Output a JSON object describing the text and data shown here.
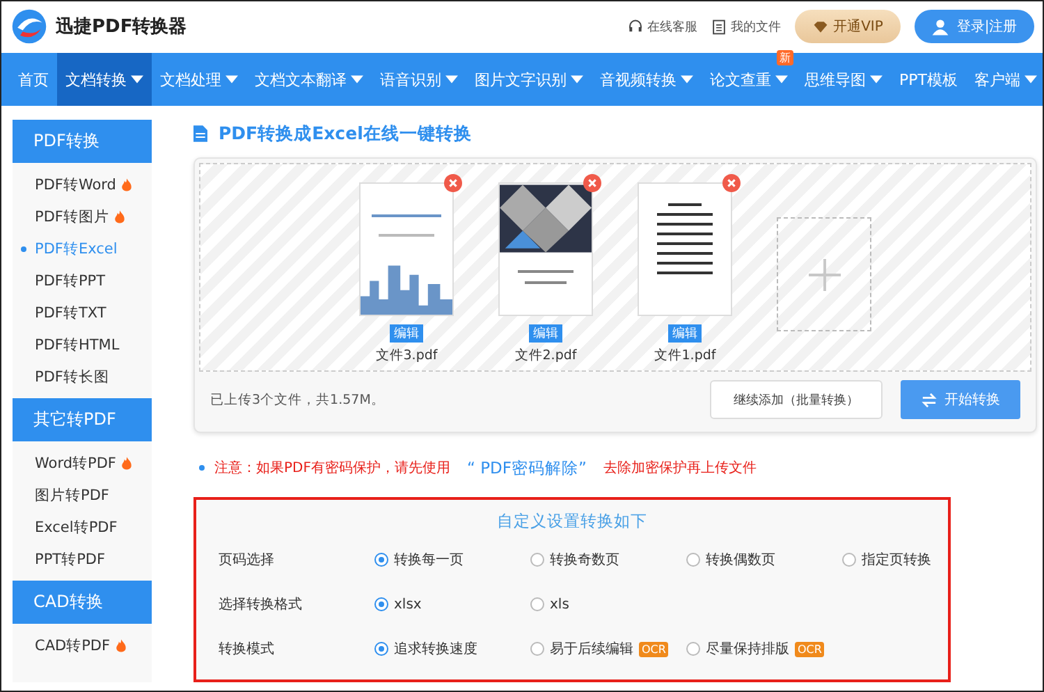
{
  "header": {
    "brand": "迅捷PDF转换器",
    "links": [
      {
        "kind": "headset",
        "label": "在线客服"
      },
      {
        "kind": "file",
        "label": "我的文件"
      }
    ],
    "vip_button": "开通VIP",
    "login_button": "登录|注册"
  },
  "nav": [
    {
      "label": "首页",
      "selected": false,
      "dropdown": false
    },
    {
      "label": "文档转换",
      "selected": true,
      "dropdown": true
    },
    {
      "label": "文档处理",
      "selected": false,
      "dropdown": true
    },
    {
      "label": "文档文本翻译",
      "selected": false,
      "dropdown": true
    },
    {
      "label": "语音识别",
      "selected": false,
      "dropdown": true
    },
    {
      "label": "图片文字识别",
      "selected": false,
      "dropdown": true
    },
    {
      "label": "音视频转换",
      "selected": false,
      "dropdown": true
    },
    {
      "label": "论文查重",
      "selected": false,
      "dropdown": true,
      "badge": "新"
    },
    {
      "label": "思维导图",
      "selected": false,
      "dropdown": true
    },
    {
      "label": "PPT模板",
      "selected": false,
      "dropdown": false
    },
    {
      "label": "客户端",
      "selected": false,
      "dropdown": true
    }
  ],
  "sidebar": [
    {
      "title": "PDF转换",
      "items": [
        {
          "label": "PDF转Word",
          "hot": true,
          "selected": false
        },
        {
          "label": "PDF转图片",
          "hot": true,
          "selected": false
        },
        {
          "label": "PDF转Excel",
          "hot": false,
          "selected": true
        },
        {
          "label": "PDF转PPT",
          "hot": false,
          "selected": false
        },
        {
          "label": "PDF转TXT",
          "hot": false,
          "selected": false
        },
        {
          "label": "PDF转HTML",
          "hot": false,
          "selected": false
        },
        {
          "label": "PDF转长图",
          "hot": false,
          "selected": false
        }
      ]
    },
    {
      "title": "其它转PDF",
      "items": [
        {
          "label": "Word转PDF",
          "hot": true,
          "selected": false
        },
        {
          "label": "图片转PDF",
          "hot": false,
          "selected": false
        },
        {
          "label": "Excel转PDF",
          "hot": false,
          "selected": false
        },
        {
          "label": "PPT转PDF",
          "hot": false,
          "selected": false
        }
      ]
    },
    {
      "title": "CAD转换",
      "items": [
        {
          "label": "CAD转PDF",
          "hot": true,
          "selected": false
        }
      ]
    }
  ],
  "page_title": "PDF转换成Excel在线一键转换",
  "files": [
    {
      "kind": "report",
      "edit": "编辑",
      "name": "文件3.pdf"
    },
    {
      "kind": "photo",
      "edit": "编辑",
      "name": "文件2.pdf"
    },
    {
      "kind": "text",
      "edit": "编辑",
      "name": "文件1.pdf"
    }
  ],
  "upload_summary": "已上传3个文件，共1.57M。",
  "add_more_button": "继续添加（批量转换）",
  "start_button": "开始转换",
  "notice": {
    "before": "注意：如果PDF有密码保护，请先使用",
    "link": "“ PDF密码解除”",
    "after": "去除加密保护再上传文件"
  },
  "settings": {
    "title": "自定义设置转换如下",
    "rows": [
      {
        "label": "页码选择",
        "options": [
          {
            "label": "转换每一页",
            "selected": true
          },
          {
            "label": "转换奇数页",
            "selected": false
          },
          {
            "label": "转换偶数页",
            "selected": false
          },
          {
            "label": "指定页转换",
            "selected": false
          }
        ]
      },
      {
        "label": "选择转换格式",
        "options": [
          {
            "label": "xlsx",
            "selected": true
          },
          {
            "label": "xls",
            "selected": false
          }
        ]
      },
      {
        "label": "转换模式",
        "options": [
          {
            "label": "追求转换速度",
            "selected": true
          },
          {
            "label": "易于后续编辑",
            "selected": false,
            "badge": "OCR"
          },
          {
            "label": "尽量保持排版",
            "selected": false,
            "badge": "OCR"
          }
        ]
      }
    ]
  }
}
